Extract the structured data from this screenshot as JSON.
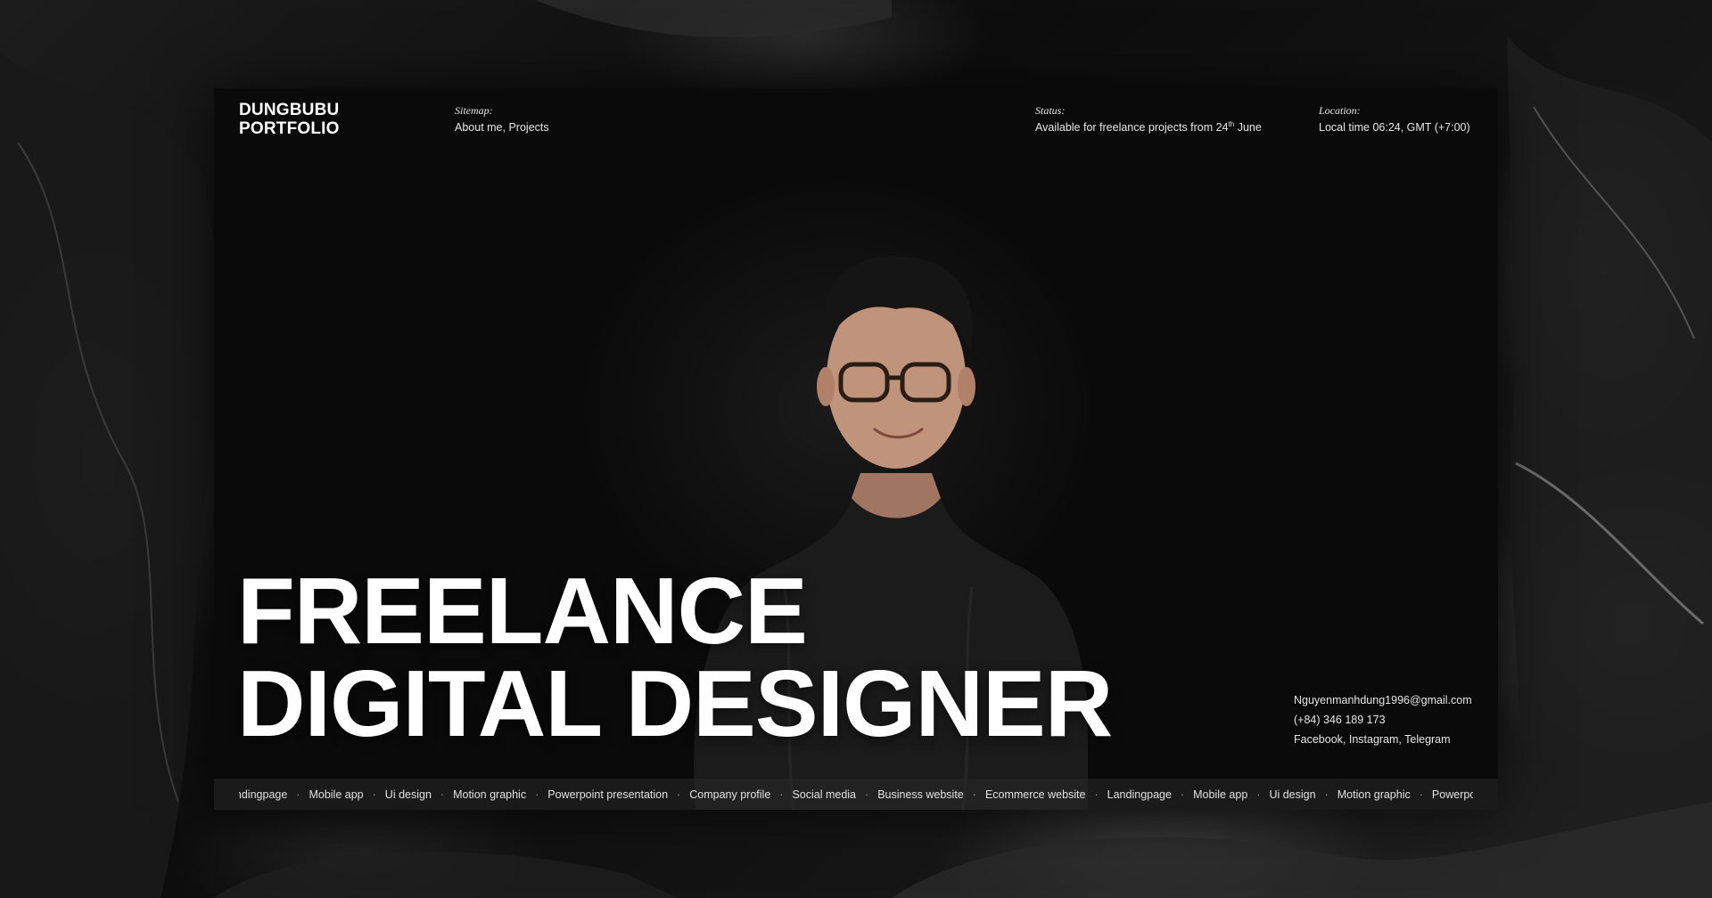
{
  "header": {
    "logo_line1": "DUNGBUBU",
    "logo_line2": "PORTFOLIO",
    "sitemap": {
      "label": "Sitemap:",
      "link_about": "About me",
      "separator": ", ",
      "link_projects": "Projects"
    },
    "status": {
      "label": "Status:",
      "text_before": "Available for freelance projects from 24",
      "superscript": "th",
      "text_after": " June"
    },
    "location": {
      "label": "Location:",
      "value": "Local time 06:24, GMT (+7:00)"
    }
  },
  "hero": {
    "line1": "FREELANCE",
    "line2": "DIGITAL DESIGNER",
    "photo": "portrait-photo"
  },
  "contact": {
    "email": "Nguyenmanhdung1996@gmail.com",
    "phone": "(+84) 346 189 173",
    "social_text": "Facebook, Instagram, Telegram"
  },
  "ticker": {
    "separator": "·",
    "items": [
      "Landingpage",
      "Mobile app",
      "Ui design",
      "Motion graphic",
      "Powerpoint presentation",
      "Company profile",
      "Social media",
      "Business website",
      "Ecommerce website",
      "Landingpage",
      "Mobile app",
      "Ui design",
      "Motion graphic",
      "Powerpoint presentation"
    ]
  },
  "colors": {
    "background": "#0b0b0b",
    "panel": "#0a0a0a",
    "text": "#ffffff",
    "ticker_bar": "#282828"
  }
}
